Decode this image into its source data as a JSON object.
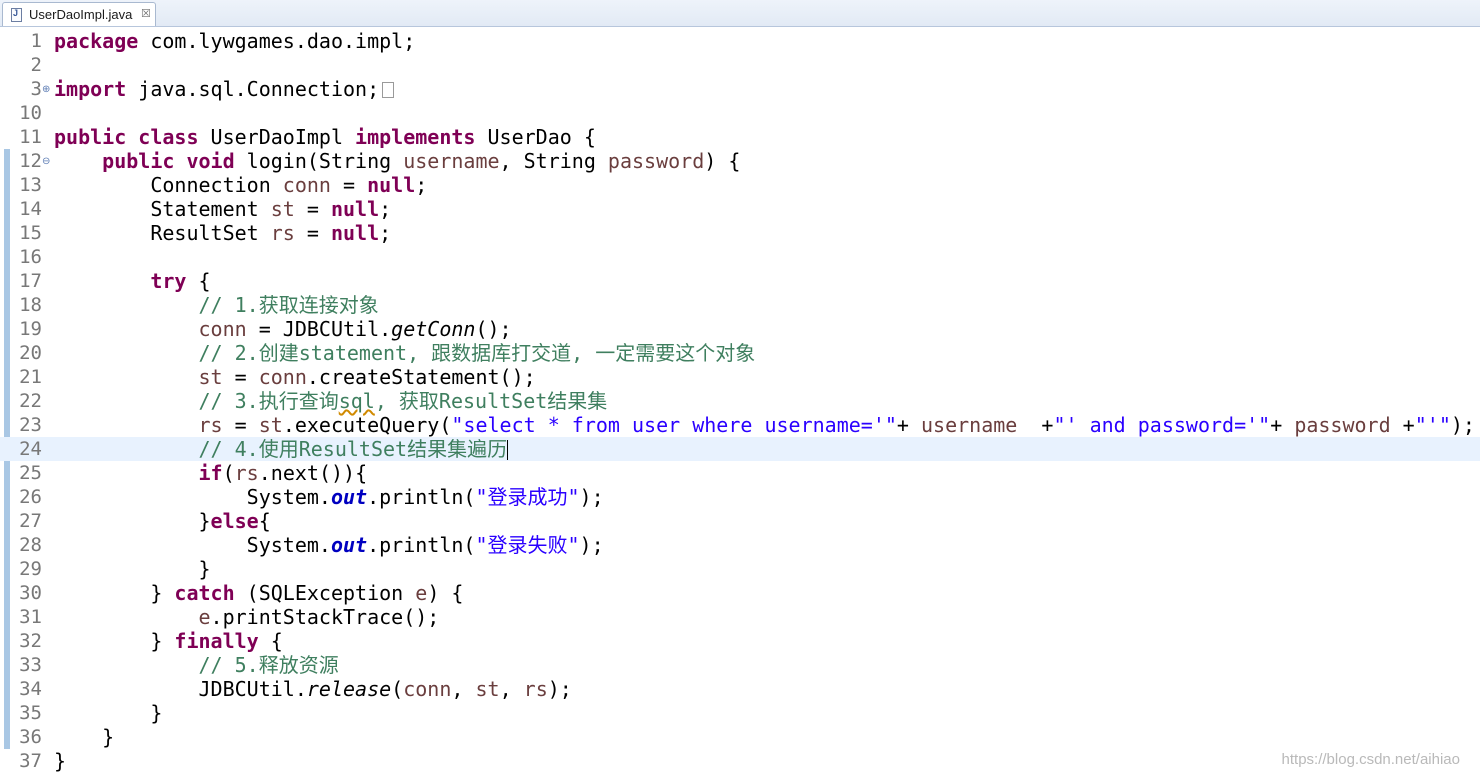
{
  "tab": {
    "title": "UserDaoImpl.java",
    "close": "☒"
  },
  "editor": {
    "lines": [
      {
        "n": "1",
        "t": "<span class='k'>package</span> com.lywgames.dao.impl;"
      },
      {
        "n": "2",
        "t": ""
      },
      {
        "n": "3",
        "t": "<span class='k'>import</span> java.sql.Connection;<span class='fbox'></span>",
        "fold": "⊕"
      },
      {
        "n": "10",
        "t": ""
      },
      {
        "n": "11",
        "t": "<span class='k'>public class</span> UserDaoImpl <span class='k'>implements</span> UserDao {"
      },
      {
        "n": "12",
        "t": "    <span class='k'>public void</span> login(String <span class='v'>username</span>, String <span class='v'>password</span>) {",
        "fold": "⊖",
        "mark": true
      },
      {
        "n": "13",
        "t": "        Connection <span class='v'>conn</span> = <span class='k'>null</span>;",
        "mark": true
      },
      {
        "n": "14",
        "t": "        Statement <span class='v'>st</span> = <span class='k'>null</span>;",
        "mark": true
      },
      {
        "n": "15",
        "t": "        ResultSet <span class='v'>rs</span> = <span class='k'>null</span>;",
        "mark": true
      },
      {
        "n": "16",
        "t": "",
        "mark": true
      },
      {
        "n": "17",
        "t": "        <span class='k'>try</span> {",
        "mark": true
      },
      {
        "n": "18",
        "t": "            <span class='c'>// 1.获取连接对象</span>",
        "mark": true
      },
      {
        "n": "19",
        "t": "            <span class='v'>conn</span> = JDBCUtil.<span class='m'>getConn</span>();",
        "mark": true
      },
      {
        "n": "20",
        "t": "            <span class='c'>// 2.创建statement, 跟数据库打交道, 一定需要这个对象</span>",
        "mark": true
      },
      {
        "n": "21",
        "t": "            <span class='v'>st</span> = <span class='v'>conn</span>.createStatement();",
        "mark": true
      },
      {
        "n": "22",
        "t": "            <span class='c'>// 3.执行查询<span class='sq'>sql</span>, 获取ResultSet结果集</span>",
        "mark": true
      },
      {
        "n": "23",
        "t": "            <span class='v'>rs</span> = <span class='v'>st</span>.executeQuery(<span class='s'>\"select * from user where username='\"</span>+ <span class='v'>username</span>  +<span class='s'>\"' and password='\"</span>+ <span class='v'>password</span> +<span class='s'>\"'\"</span>);",
        "mark": true
      },
      {
        "n": "24",
        "t": "            <span class='c'>// 4.使用ResultSet结果集遍历</span><span class='caret'></span>",
        "mark": true,
        "current": true
      },
      {
        "n": "25",
        "t": "            <span class='k'>if</span>(<span class='v'>rs</span>.next()){",
        "mark": true
      },
      {
        "n": "26",
        "t": "                System.<span class='f'>out</span>.println(<span class='s'>\"登录成功\"</span>);",
        "mark": true
      },
      {
        "n": "27",
        "t": "            }<span class='k'>else</span>{",
        "mark": true
      },
      {
        "n": "28",
        "t": "                System.<span class='f'>out</span>.println(<span class='s'>\"登录失败\"</span>);",
        "mark": true
      },
      {
        "n": "29",
        "t": "            }",
        "mark": true
      },
      {
        "n": "30",
        "t": "        } <span class='k'>catch</span> (SQLException <span class='v'>e</span>) {",
        "mark": true
      },
      {
        "n": "31",
        "t": "            <span class='v'>e</span>.printStackTrace();",
        "mark": true
      },
      {
        "n": "32",
        "t": "        } <span class='k'>finally</span> {",
        "mark": true
      },
      {
        "n": "33",
        "t": "            <span class='c'>// 5.释放资源</span>",
        "mark": true
      },
      {
        "n": "34",
        "t": "            JDBCUtil.<span class='m'>release</span>(<span class='v'>conn</span>, <span class='v'>st</span>, <span class='v'>rs</span>);",
        "mark": true
      },
      {
        "n": "35",
        "t": "        }",
        "mark": true
      },
      {
        "n": "36",
        "t": "    }",
        "mark": true
      },
      {
        "n": "37",
        "t": "}"
      }
    ]
  },
  "watermark": "https://blog.csdn.net/aihiao"
}
